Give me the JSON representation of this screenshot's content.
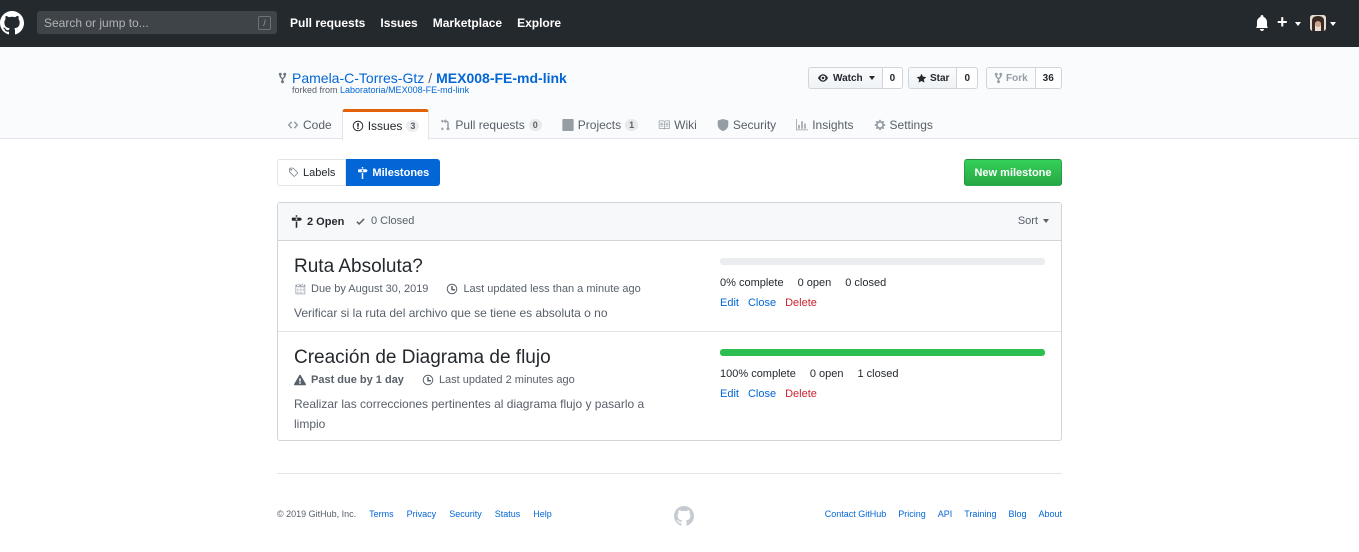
{
  "header": {
    "search_placeholder": "Search or jump to...",
    "search_shortcut": "/",
    "nav": [
      "Pull requests",
      "Issues",
      "Marketplace",
      "Explore"
    ],
    "plus_label": "+"
  },
  "repo": {
    "owner": "Pamela-C-Torres-Gtz",
    "separator": "/",
    "name": "MEX008-FE-md-link",
    "forked_prefix": "forked from",
    "forked_source": "Laboratoria/MEX008-FE-md-link"
  },
  "actions": {
    "watch_label": "Watch",
    "watch_count": "0",
    "star_label": "Star",
    "star_count": "0",
    "fork_label": "Fork",
    "fork_count": "36"
  },
  "reponav": {
    "code": "Code",
    "issues": "Issues",
    "issues_count": "3",
    "pull_requests": "Pull requests",
    "pull_requests_count": "0",
    "projects": "Projects",
    "projects_count": "1",
    "wiki": "Wiki",
    "security": "Security",
    "insights": "Insights",
    "settings": "Settings"
  },
  "subnav": {
    "labels": "Labels",
    "milestones": "Milestones",
    "new_milestone": "New milestone"
  },
  "box_header": {
    "open": "2 Open",
    "closed": "0 Closed",
    "sort": "Sort"
  },
  "milestones": [
    {
      "title": "Ruta Absoluta?",
      "due": "Due by August 30, 2019",
      "updated": "Last updated less than a minute ago",
      "description": "Verificar si la ruta del archivo que se tiene es absoluta o no",
      "progress": 0,
      "complete": "0% complete",
      "open": "0 open",
      "closed": "0 closed",
      "edit": "Edit",
      "close": "Close",
      "delete": "Delete"
    },
    {
      "title": "Creación de Diagrama de flujo",
      "due": "Past due by 1 day",
      "updated": "Last updated 2 minutes ago",
      "description": "Realizar las correcciones pertinentes al diagrama flujo y pasarlo a limpio",
      "progress": 100,
      "complete": "100% complete",
      "open": "0 open",
      "closed": "1 closed",
      "edit": "Edit",
      "close": "Close",
      "delete": "Delete"
    }
  ],
  "footer": {
    "copyright": "© 2019 GitHub, Inc.",
    "left_links": [
      "Terms",
      "Privacy",
      "Security",
      "Status",
      "Help"
    ],
    "right_links": [
      "Contact GitHub",
      "Pricing",
      "API",
      "Training",
      "Blog",
      "About"
    ]
  },
  "colors": {
    "header_bg": "#24292e",
    "link": "#0366d6",
    "selected_tab_accent": "#e36209",
    "green_button": "#28a745",
    "progress_fill": "#2cbe4e",
    "delete": "#cb2431"
  }
}
